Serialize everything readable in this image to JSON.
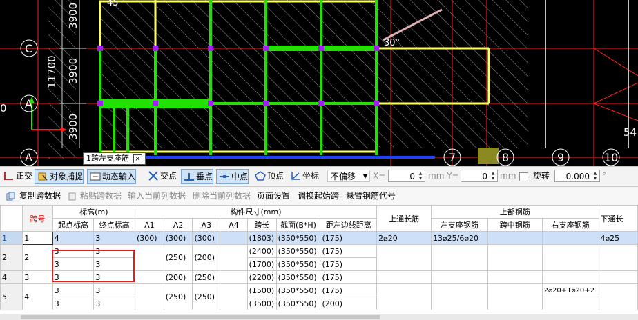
{
  "cad": {
    "axis_letters": [
      "C",
      "A",
      "A"
    ],
    "axis_numbers": [
      "7",
      "8",
      "9",
      "10"
    ],
    "dims": [
      "3900",
      "3900",
      "11700",
      "3900",
      "0",
      "54",
      "30°",
      "45"
    ],
    "tooltip": "1跨左支座筋",
    "tooltip_close": "×"
  },
  "snap_toolbar": {
    "items": [
      {
        "label": "正交",
        "icon": "orthogonal-icon"
      },
      {
        "label": "对象捕捉",
        "icon": "object-snap-icon"
      },
      {
        "label": "动态输入",
        "icon": "dynamic-input-icon"
      },
      {
        "label": "交点",
        "icon": "intersection-icon"
      },
      {
        "label": "垂点",
        "icon": "perpendicular-icon"
      },
      {
        "label": "中点",
        "icon": "midpoint-icon"
      },
      {
        "label": "顶点",
        "icon": "vertex-icon"
      },
      {
        "label": "坐标",
        "icon": "coordinate-icon"
      }
    ],
    "offset_select": "不偏移",
    "x_label": "X=",
    "x_value": "0",
    "y_label": "mm Y=",
    "y_value": "0",
    "mm_label": "mm",
    "rotate_label": "旋转",
    "rotate_value": "0.000",
    "degree": "°"
  },
  "command_bar": {
    "items": [
      {
        "label": "复制跨数据",
        "enabled": false
      },
      {
        "label": "粘贴跨数据",
        "enabled": false
      },
      {
        "label": "输入当前列数据",
        "enabled": false
      },
      {
        "label": "删除当前列数据",
        "enabled": false
      },
      {
        "label": "页面设置",
        "enabled": true
      },
      {
        "label": "调换起始跨",
        "enabled": true
      },
      {
        "label": "悬臂钢筋代号",
        "enabled": true
      }
    ]
  },
  "grid": {
    "headers": {
      "span_no": "跨号",
      "elevation": "标高(m)",
      "start_elev": "起点标高",
      "end_elev": "终点标高",
      "member_size": "构件尺寸(mm)",
      "A1": "A1",
      "A2": "A2",
      "A3": "A3",
      "A4": "A4",
      "span_len": "跨长",
      "section": "截面(B*H)",
      "dist_left": "距左边线距离",
      "top_through": "上通长筋",
      "top_rebar": "上部钢筋",
      "left_support": "左支座钢筋",
      "mid_span": "跨中钢筋",
      "right_support": "右支座钢筋",
      "bottom_through": "下通长"
    },
    "rows": [
      {
        "row": "1",
        "span": "1",
        "start": "4",
        "end": "3",
        "a1": "(300)",
        "a2": "(300)",
        "a3": "(300)",
        "a4": "",
        "len": "(1803)",
        "sec": "(350*550)",
        "dist": "(175)",
        "top": "2⌀20",
        "left": "13⌀25/6⌀20",
        "mid": "",
        "right": "",
        "bottom": "4⌀25"
      },
      {
        "row": "2",
        "span": "2",
        "start": "3",
        "end": "3",
        "a1": "",
        "a2": "(250)",
        "a3": "(200)",
        "a4": "",
        "len": "(2400)",
        "sec": "(350*550)",
        "dist": "(175)",
        "top": "",
        "left": "",
        "mid": "",
        "right": "",
        "bottom": ""
      },
      {
        "row": "",
        "span": "",
        "start": "3",
        "end": "3",
        "a1": "",
        "a2": "",
        "a3": "",
        "a4": "",
        "len": "(1700)",
        "sec": "(350*550)",
        "dist": "(175)",
        "top": "",
        "left": "",
        "mid": "",
        "right": "",
        "bottom": ""
      },
      {
        "row": "4",
        "span": "3",
        "start": "3",
        "end": "3",
        "a1": "",
        "a2": "(200)",
        "a3": "(250)",
        "a4": "",
        "len": "(2200)",
        "sec": "(350*550)",
        "dist": "(175)",
        "top": "",
        "left": "",
        "mid": "",
        "right": "",
        "bottom": ""
      },
      {
        "row": "5",
        "span": "4",
        "start": "3",
        "end": "3",
        "a1": "",
        "a2": "(250)",
        "a3": "(250)",
        "a4": "",
        "len": "(1500)",
        "sec": "(350*550)",
        "dist": "(175)",
        "top": "",
        "left": "",
        "mid": "",
        "right": "2⌀20+1⌀20+2",
        "bottom": ""
      },
      {
        "row": "",
        "span": "",
        "start": "3",
        "end": "3",
        "a1": "",
        "a2": "",
        "a3": "",
        "a4": "",
        "len": "(3500)",
        "sec": "(350*550)",
        "dist": "(200)",
        "top": "",
        "left": "",
        "mid": "",
        "right": "",
        "bottom": ""
      }
    ]
  },
  "colors": {
    "beam_green": "#22e000",
    "beam_yellow": "#ffff66",
    "grid_red": "#ff2020",
    "node_purple": "#a020f0",
    "highlight_box": "#e21b1b",
    "selected_row": "#cde0f7"
  }
}
